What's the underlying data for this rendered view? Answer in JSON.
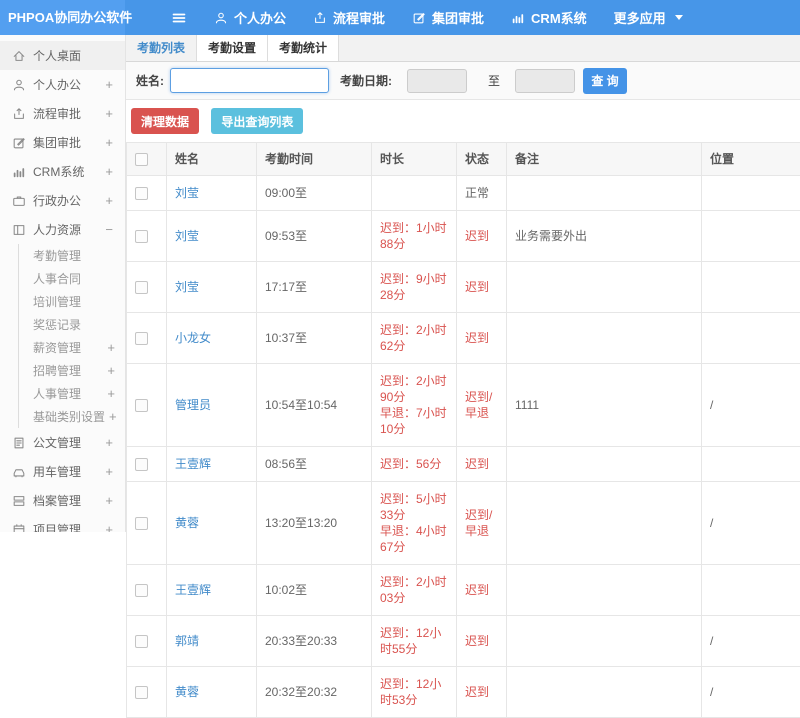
{
  "colors": {
    "navbar": "#4796e8",
    "brand_bg": "#539ff0",
    "link": "#428bca",
    "danger": "#d9534f",
    "info": "#5bc0de",
    "primary": "#4493e7"
  },
  "topnav": {
    "brand": "PHPOA协同办公软件",
    "items": [
      {
        "id": "personal-office",
        "label": "个人办公",
        "icon": "user"
      },
      {
        "id": "workflow-approval",
        "label": "流程审批",
        "icon": "flow"
      },
      {
        "id": "group-approval",
        "label": "集团审批",
        "icon": "edit"
      },
      {
        "id": "crm",
        "label": "CRM系统",
        "icon": "chart"
      },
      {
        "id": "more-apps",
        "label": "更多应用",
        "icon": "caret"
      }
    ]
  },
  "sidebar": {
    "items": [
      {
        "id": "desktop",
        "label": "个人桌面",
        "icon": "home",
        "expand": "",
        "active": true
      },
      {
        "id": "personal-office",
        "label": "个人办公",
        "icon": "user",
        "expand": "+"
      },
      {
        "id": "workflow-approval",
        "label": "流程审批",
        "icon": "flow",
        "expand": "+"
      },
      {
        "id": "group-approval",
        "label": "集团审批",
        "icon": "edit",
        "expand": "+"
      },
      {
        "id": "crm",
        "label": "CRM系统",
        "icon": "chart",
        "expand": "+"
      },
      {
        "id": "admin-office",
        "label": "行政办公",
        "icon": "brief",
        "expand": "+"
      },
      {
        "id": "hr",
        "label": "人力资源",
        "icon": "hr",
        "expand": "−"
      },
      {
        "id": "attendance",
        "label": "考勤管理",
        "sub": true,
        "expand": ""
      },
      {
        "id": "hr-contract",
        "label": "人事合同",
        "sub": true,
        "expand": ""
      },
      {
        "id": "training",
        "label": "培训管理",
        "sub": true,
        "expand": ""
      },
      {
        "id": "rewards",
        "label": "奖惩记录",
        "sub": true,
        "expand": ""
      },
      {
        "id": "salary",
        "label": "薪资管理",
        "sub": true,
        "expand": "+"
      },
      {
        "id": "recruitment",
        "label": "招聘管理",
        "sub": true,
        "expand": "+"
      },
      {
        "id": "personnel",
        "label": "人事管理",
        "sub": true,
        "expand": "+"
      },
      {
        "id": "base-category",
        "label": "基础类别设置",
        "sub": true,
        "expand": "+"
      },
      {
        "id": "documents",
        "label": "公文管理",
        "icon": "doc",
        "expand": "+"
      },
      {
        "id": "vehicles",
        "label": "用车管理",
        "icon": "car",
        "expand": "+"
      },
      {
        "id": "archives",
        "label": "档案管理",
        "icon": "archive",
        "expand": "+"
      },
      {
        "id": "projects",
        "label": "项目管理",
        "icon": "project",
        "expand": "+"
      }
    ]
  },
  "tabs": [
    {
      "id": "attendance-list",
      "label": "考勤列表",
      "active": true
    },
    {
      "id": "attendance-settings",
      "label": "考勤设置",
      "active": false
    },
    {
      "id": "attendance-stats",
      "label": "考勤统计",
      "active": false
    }
  ],
  "search": {
    "name_label": "姓名:",
    "name_value": "",
    "date_label": "考勤日期:",
    "date_from_value": "",
    "to_label": "至",
    "date_to_value": "",
    "query_button": "查 询"
  },
  "actions": {
    "clean_button": "清理数据",
    "export_button": "导出查询列表"
  },
  "table": {
    "headers": [
      "姓名",
      "考勤时间",
      "时长",
      "状态",
      "备注",
      "位置"
    ],
    "rows": [
      {
        "name": "刘莹",
        "time": "09:00至",
        "duration": "",
        "status": "正常",
        "alert": false,
        "note": "",
        "location": ""
      },
      {
        "name": "刘莹",
        "time": "09:53至",
        "duration": "迟到：1小时88分",
        "status": "迟到",
        "alert": true,
        "note": "业务需要外出",
        "location": ""
      },
      {
        "name": "刘莹",
        "time": "17:17至",
        "duration": "迟到：9小时28分",
        "status": "迟到",
        "alert": true,
        "note": "",
        "location": ""
      },
      {
        "name": "小龙女",
        "time": "10:37至",
        "duration": "迟到：2小时62分",
        "status": "迟到",
        "alert": true,
        "note": "",
        "location": ""
      },
      {
        "name": "管理员",
        "time": "10:54至10:54",
        "duration": "迟到：2小时90分\n早退：7小时10分",
        "status": "迟到/早退",
        "alert": true,
        "note": "1111",
        "location": "/"
      },
      {
        "name": "王壹辉",
        "time": "08:56至",
        "duration": "迟到：56分",
        "status": "迟到",
        "alert": true,
        "note": "",
        "location": ""
      },
      {
        "name": "黄蓉",
        "time": "13:20至13:20",
        "duration": "迟到：5小时33分\n早退：4小时67分",
        "status": "迟到/早退",
        "alert": true,
        "note": "",
        "location": "/"
      },
      {
        "name": "王壹辉",
        "time": "10:02至",
        "duration": "迟到：2小时03分",
        "status": "迟到",
        "alert": true,
        "note": "",
        "location": ""
      },
      {
        "name": "郭靖",
        "time": "20:33至20:33",
        "duration": "迟到：12小时55分",
        "status": "迟到",
        "alert": true,
        "note": "",
        "location": "/"
      },
      {
        "name": "黄蓉",
        "time": "20:32至20:32",
        "duration": "迟到：12小时53分",
        "status": "迟到",
        "alert": true,
        "note": "",
        "location": "/"
      }
    ]
  }
}
